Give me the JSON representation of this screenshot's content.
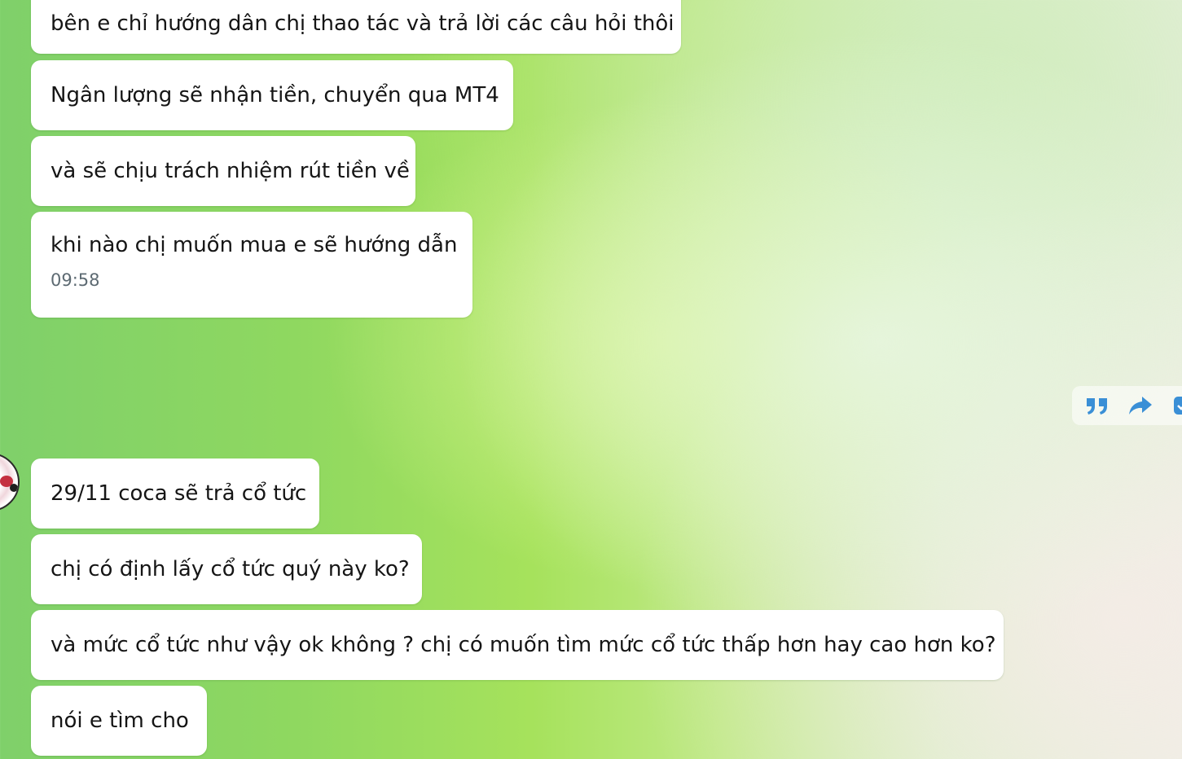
{
  "messages": [
    {
      "text": "bên e chỉ hướng dân chị thao tác và trả lời các câu hỏi thôi"
    },
    {
      "text": "Ngân lượng sẽ nhận tiền, chuyển qua MT4"
    },
    {
      "text": "và sẽ chịu trách nhiệm rút tiền về"
    },
    {
      "text": "khi nào chị muốn mua e sẽ hướng dẫn",
      "time": "09:58"
    },
    {
      "text": "29/11 coca sẽ trả cổ tức"
    },
    {
      "text": "chị có định lấy cổ tức quý này ko?"
    },
    {
      "text": "và mức cổ tức như vậy ok không ? chị có muốn tìm mức cổ tức thấp hơn hay cao hơn ko?"
    },
    {
      "text": "nói e tìm cho"
    }
  ],
  "hover_toolbar": {
    "icons": [
      "quote-icon",
      "forward-icon",
      "select-icon"
    ],
    "accent": "#3a8fd6"
  },
  "colors": {
    "bubble": "#ffffff",
    "text": "#151515",
    "time": "#5d6a72"
  }
}
